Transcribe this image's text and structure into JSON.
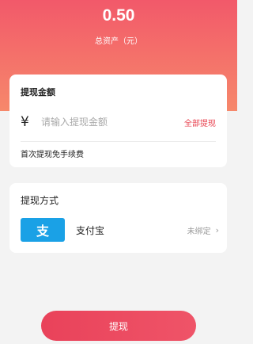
{
  "header": {
    "balance": "0.50",
    "balance_label": "总资产（元）"
  },
  "withdraw_card": {
    "title": "提现金额",
    "currency_symbol": "¥",
    "amount_placeholder": "请输入提现金额",
    "all_button_label": "全部提现",
    "fee_note": "首次提现免手续费"
  },
  "method_card": {
    "title": "提现方式",
    "method_logo_text": "支",
    "method_name": "支付宝",
    "bind_status": "未绑定",
    "chevron": "›"
  },
  "footer": {
    "submit_label": "提现"
  },
  "colors": {
    "header_gradient_top": "#f2596a",
    "header_gradient_bottom": "#f6886b",
    "accent_red": "#e8424f",
    "alipay_blue": "#1aa1e6"
  },
  "icons": {
    "alipay": "alipay-logo-icon",
    "arrow": "chevron-right-icon"
  }
}
